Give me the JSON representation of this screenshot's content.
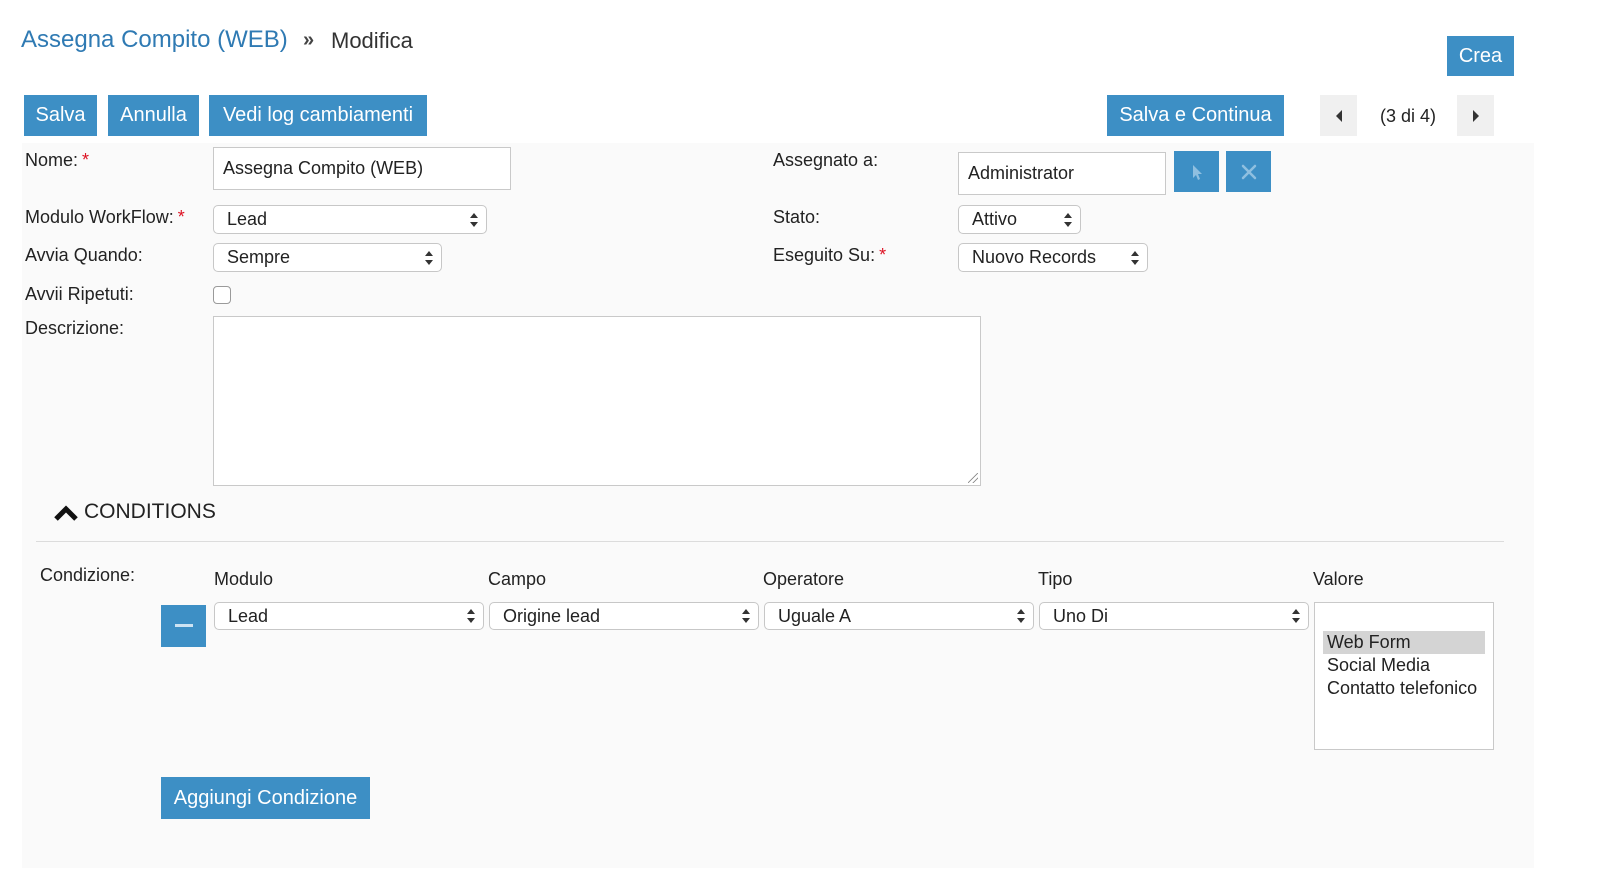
{
  "breadcrumb": {
    "parent": "Assegna Compito (WEB)",
    "separator": "»",
    "current": "Modifica"
  },
  "header": {
    "create_label": "Crea"
  },
  "toolbar": {
    "save_label": "Salva",
    "cancel_label": "Annulla",
    "changelog_label": "Vedi log cambiamenti",
    "save_continue_label": "Salva e Continua",
    "pager_text": "(3 di 4)"
  },
  "form": {
    "required_mark": "*",
    "name_label": "Nome:",
    "name_value": "Assegna Compito (WEB)",
    "workflow_module_label": "Modulo WorkFlow:",
    "workflow_module_value": "Lead",
    "start_when_label": "Avvia Quando:",
    "start_when_value": "Sempre",
    "repeated_runs_label": "Avvii Ripetuti:",
    "repeated_runs_checked": false,
    "description_label": "Descrizione:",
    "description_value": "",
    "assigned_to_label": "Assegnato a:",
    "assigned_to_value": "Administrator",
    "status_label": "Stato:",
    "status_value": "Attivo",
    "run_on_label": "Eseguito Su:",
    "run_on_value": "Nuovo Records"
  },
  "conditions": {
    "section_title": "CONDITIONS",
    "row_label": "Condizione:",
    "headers": {
      "module": "Modulo",
      "field": "Campo",
      "operator": "Operatore",
      "type": "Tipo",
      "value": "Valore"
    },
    "row": {
      "module": "Lead",
      "field": "Origine lead",
      "operator": "Uguale A",
      "type": "Uno Di",
      "value_options": [
        {
          "label": "Web Form",
          "selected": true
        },
        {
          "label": "Social Media",
          "selected": false
        },
        {
          "label": "Contatto telefonico",
          "selected": false
        }
      ]
    },
    "add_label": "Aggiungi Condizione"
  },
  "colors": {
    "accent": "#3d8fc5",
    "link": "#2f7ab3",
    "required": "#dd1122"
  }
}
